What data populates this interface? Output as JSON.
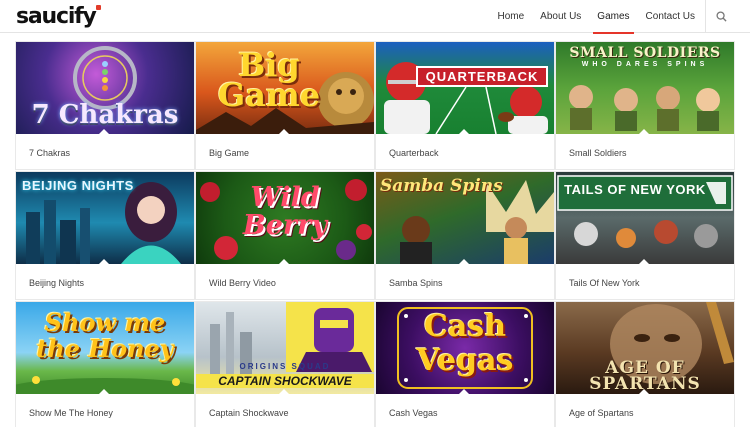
{
  "brand": {
    "name": "saucify",
    "accent": "#e5352a"
  },
  "nav": {
    "items": [
      {
        "label": "Home",
        "active": false
      },
      {
        "label": "About Us",
        "active": false
      },
      {
        "label": "Games",
        "active": true
      },
      {
        "label": "Contact Us",
        "active": false
      }
    ],
    "search_icon": "search-icon"
  },
  "games": [
    {
      "title": "7 Chakras",
      "art": "7 Chakras"
    },
    {
      "title": "Big Game",
      "art": "Big Game"
    },
    {
      "title": "Quarterback",
      "art": "QUARTERBACK"
    },
    {
      "title": "Small Soldiers",
      "art": "SMALL SOLDIERS",
      "art_sub": "WHO DARES SPINS"
    },
    {
      "title": "Beijing Nights",
      "art": "BEIJING NIGHTS"
    },
    {
      "title": "Wild Berry Video",
      "art": "Wild Berry"
    },
    {
      "title": "Samba Spins",
      "art": "Samba Spins"
    },
    {
      "title": "Tails Of New York",
      "art": "TAILS OF NEW YORK"
    },
    {
      "title": "Show Me The Honey",
      "art": "Show me the Honey"
    },
    {
      "title": "Captain Shockwave",
      "art": "CAPTAIN SHOCKWAVE",
      "art_sub": "ORIGINS SQUAD"
    },
    {
      "title": "Cash Vegas",
      "art": "Cash Vegas"
    },
    {
      "title": "Age of Spartans",
      "art": "AGE OF SPARTANS"
    }
  ]
}
